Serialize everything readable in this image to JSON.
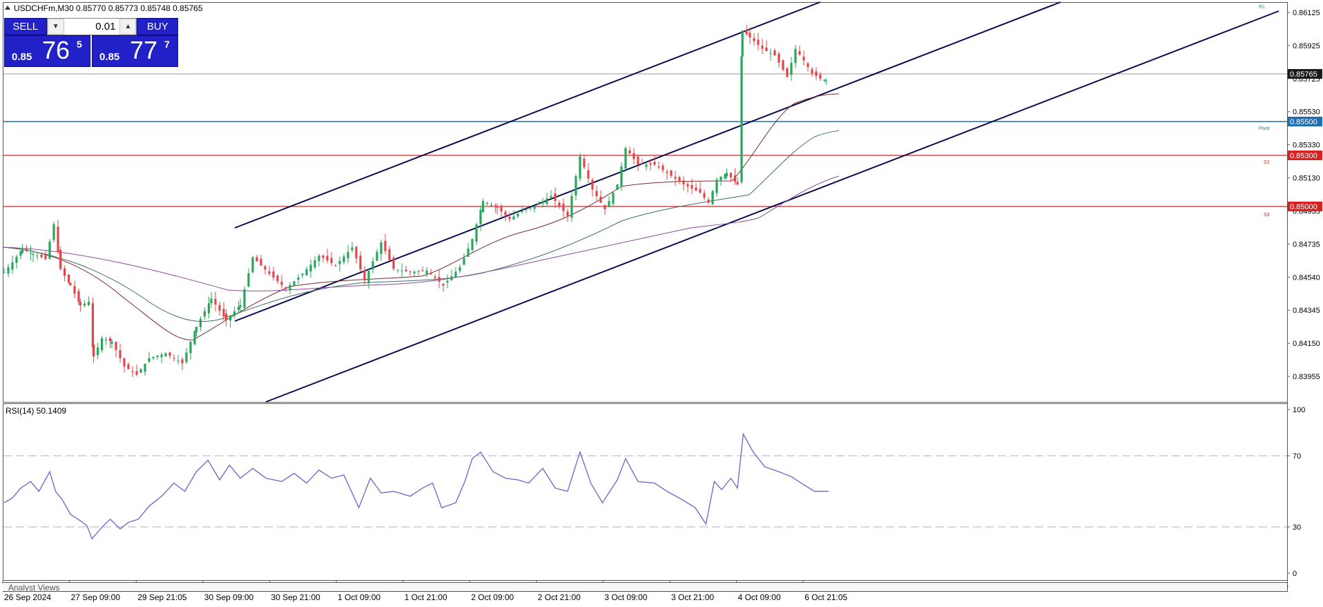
{
  "symbol_header": {
    "collapse_icon": "triangle-up-icon",
    "title": "USDCHFm,M30  0.85770 0.85773 0.85748 0.85765"
  },
  "trade_panel": {
    "sell_label": "SELL",
    "buy_label": "BUY",
    "lot_value": "0.01",
    "spin_down_icon": "▼",
    "spin_up_icon": "▲",
    "bid_prefix": "0.85",
    "bid_big": "76",
    "bid_sup": "5",
    "ask_prefix": "0.85",
    "ask_big": "77",
    "ask_sup": "7"
  },
  "price_axis": {
    "ticks": [
      "0.86125",
      "0.85925",
      "0.85725",
      "0.85530",
      "0.85330",
      "0.85130",
      "0.84935",
      "0.84735",
      "0.84540",
      "0.84345",
      "0.84150",
      "0.83955"
    ],
    "current_price": "0.85765",
    "current_price_color": "#000000"
  },
  "levels": [
    {
      "price": "0.85500",
      "tag": "Pivot",
      "color": "#1f6fb4"
    },
    {
      "price": "0.85300",
      "tag": "S2",
      "color": "#d82020"
    },
    {
      "price": "0.85000",
      "tag": "S3",
      "color": "#d82020"
    }
  ],
  "r1_tag": "R1",
  "rsi": {
    "label": "RSI(14) 50.1409",
    "ticks": [
      "100",
      "70",
      "30",
      "0"
    ],
    "line_color": "#7b68c8"
  },
  "time_axis": {
    "labels": [
      "26 Sep 2024",
      "27 Sep 09:00",
      "29 Sep 21:05",
      "30 Sep 09:00",
      "30 Sep 21:00",
      "1 Oct 09:00",
      "1 Oct 21:00",
      "2 Oct 09:00",
      "2 Oct 21:00",
      "3 Oct 09:00",
      "3 Oct 21:00",
      "4 Oct 09:00",
      "6 Oct 21:05"
    ]
  },
  "analyst_views_label": "Analyst Views",
  "colors": {
    "bull": "#26a65b",
    "bear": "#e0454a",
    "channel": "#0b0b50",
    "ma_fast": "#7a2b2b",
    "ma_mid": "#3b6b6b",
    "ma_slow": "#8a4b9a"
  },
  "chart_data": {
    "type": "candlestick",
    "symbol": "USDCHFm",
    "timeframe": "M30",
    "ylim": [
      0.8387,
      0.8617
    ],
    "open": 0.8577,
    "high": 0.85773,
    "low": 0.85748,
    "close": 0.85765,
    "price_path": [
      [
        0,
        0.846
      ],
      [
        10,
        0.8466
      ],
      [
        22,
        0.8474
      ],
      [
        35,
        0.8471
      ],
      [
        50,
        0.8468
      ],
      [
        60,
        0.8489
      ],
      [
        68,
        0.8462
      ],
      [
        80,
        0.8452
      ],
      [
        92,
        0.844
      ],
      [
        102,
        0.8442
      ],
      [
        108,
        0.8409
      ],
      [
        118,
        0.842
      ],
      [
        130,
        0.8418
      ],
      [
        145,
        0.8403
      ],
      [
        160,
        0.8398
      ],
      [
        175,
        0.8408
      ],
      [
        195,
        0.8411
      ],
      [
        215,
        0.8405
      ],
      [
        232,
        0.8427
      ],
      [
        250,
        0.8444
      ],
      [
        268,
        0.8431
      ],
      [
        285,
        0.844
      ],
      [
        300,
        0.8469
      ],
      [
        320,
        0.8459
      ],
      [
        340,
        0.845
      ],
      [
        360,
        0.8459
      ],
      [
        380,
        0.847
      ],
      [
        400,
        0.8464
      ],
      [
        420,
        0.8475
      ],
      [
        435,
        0.8455
      ],
      [
        455,
        0.8478
      ],
      [
        470,
        0.8462
      ],
      [
        490,
        0.846
      ],
      [
        510,
        0.8461
      ],
      [
        530,
        0.8452
      ],
      [
        550,
        0.8463
      ],
      [
        565,
        0.848
      ],
      [
        578,
        0.8503
      ],
      [
        595,
        0.8499
      ],
      [
        610,
        0.8492
      ],
      [
        625,
        0.8497
      ],
      [
        640,
        0.85
      ],
      [
        660,
        0.8506
      ],
      [
        680,
        0.8494
      ],
      [
        695,
        0.853
      ],
      [
        710,
        0.851
      ],
      [
        725,
        0.8498
      ],
      [
        740,
        0.8513
      ],
      [
        750,
        0.8535
      ],
      [
        765,
        0.8525
      ],
      [
        785,
        0.8525
      ],
      [
        800,
        0.852
      ],
      [
        820,
        0.8513
      ],
      [
        840,
        0.8508
      ],
      [
        850,
        0.8502
      ],
      [
        860,
        0.8516
      ],
      [
        872,
        0.852
      ],
      [
        885,
        0.8513
      ],
      [
        891,
        0.8606
      ],
      [
        900,
        0.8602
      ],
      [
        915,
        0.8595
      ],
      [
        930,
        0.8591
      ],
      [
        945,
        0.8578
      ],
      [
        955,
        0.8595
      ],
      [
        965,
        0.8588
      ],
      [
        975,
        0.858
      ],
      [
        985,
        0.8577
      ],
      [
        992,
        0.8576
      ]
    ],
    "rsi_path": [
      [
        0,
        43
      ],
      [
        10,
        46
      ],
      [
        20,
        52
      ],
      [
        32,
        56
      ],
      [
        42,
        50
      ],
      [
        55,
        62
      ],
      [
        62,
        50
      ],
      [
        70,
        45
      ],
      [
        80,
        36
      ],
      [
        92,
        32
      ],
      [
        100,
        29
      ],
      [
        106,
        21
      ],
      [
        118,
        28
      ],
      [
        128,
        33
      ],
      [
        140,
        27
      ],
      [
        150,
        31
      ],
      [
        162,
        33
      ],
      [
        175,
        41
      ],
      [
        190,
        47
      ],
      [
        205,
        55
      ],
      [
        218,
        50
      ],
      [
        232,
        62
      ],
      [
        246,
        69
      ],
      [
        260,
        57
      ],
      [
        272,
        66
      ],
      [
        285,
        58
      ],
      [
        300,
        64
      ],
      [
        316,
        58
      ],
      [
        335,
        56
      ],
      [
        350,
        61
      ],
      [
        365,
        55
      ],
      [
        380,
        63
      ],
      [
        395,
        58
      ],
      [
        410,
        60
      ],
      [
        428,
        40
      ],
      [
        442,
        58
      ],
      [
        455,
        49
      ],
      [
        470,
        50
      ],
      [
        490,
        47
      ],
      [
        505,
        52
      ],
      [
        517,
        55
      ],
      [
        528,
        40
      ],
      [
        545,
        43
      ],
      [
        556,
        56
      ],
      [
        565,
        70
      ],
      [
        575,
        74
      ],
      [
        590,
        62
      ],
      [
        605,
        58
      ],
      [
        620,
        57
      ],
      [
        633,
        55
      ],
      [
        650,
        64
      ],
      [
        665,
        52
      ],
      [
        680,
        50
      ],
      [
        695,
        74
      ],
      [
        708,
        55
      ],
      [
        722,
        43
      ],
      [
        740,
        57
      ],
      [
        750,
        70
      ],
      [
        765,
        56
      ],
      [
        785,
        55
      ],
      [
        800,
        50
      ],
      [
        818,
        45
      ],
      [
        834,
        40
      ],
      [
        847,
        30
      ],
      [
        857,
        56
      ],
      [
        866,
        51
      ],
      [
        877,
        58
      ],
      [
        885,
        52
      ],
      [
        892,
        85
      ],
      [
        904,
        74
      ],
      [
        918,
        65
      ],
      [
        935,
        62
      ],
      [
        950,
        59
      ],
      [
        965,
        54
      ],
      [
        978,
        50
      ],
      [
        995,
        50
      ]
    ]
  }
}
